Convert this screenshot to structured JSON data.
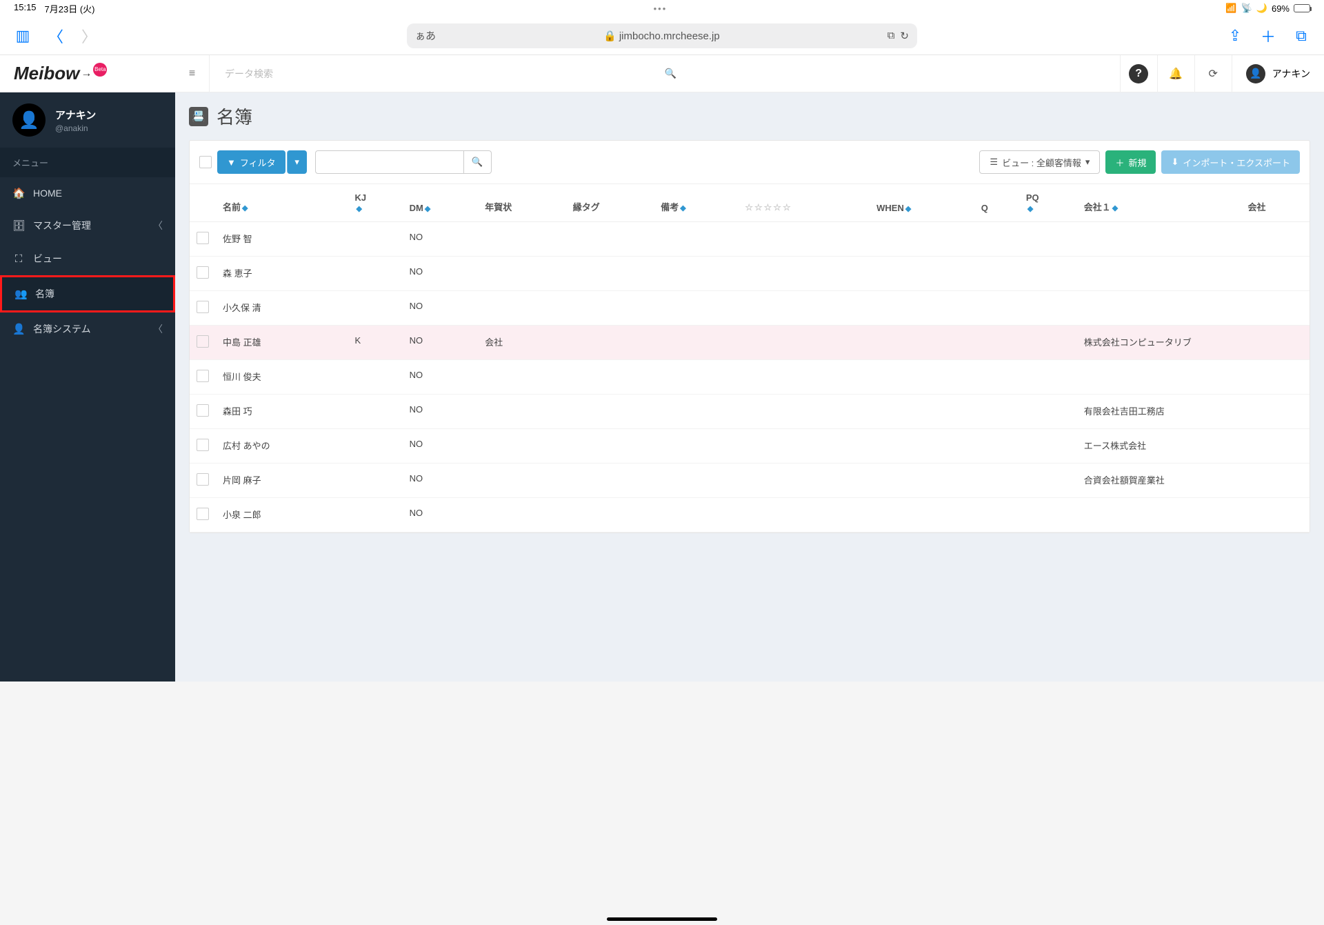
{
  "ios": {
    "time": "15:15",
    "date": "7月23日 (火)",
    "battery": "69%"
  },
  "safari": {
    "aa": "ぁあ",
    "lock": "🔒",
    "domain": "jimbocho.mrcheese.jp"
  },
  "logo": {
    "text": "Meibow",
    "badge": "Beta"
  },
  "profile": {
    "name": "アナキン",
    "handle": "@anakin"
  },
  "menu": {
    "label": "メニュー"
  },
  "nav": {
    "home": "HOME",
    "master": "マスター管理",
    "view": "ビュー",
    "meibo": "名簿",
    "system": "名簿システム"
  },
  "topbar": {
    "search_placeholder": "データ検索",
    "user": "アナキン"
  },
  "page": {
    "title": "名簿"
  },
  "toolbar": {
    "filter": "フィルタ",
    "view_btn": "ビュー : 全顧客情報",
    "new": "新規",
    "import": "インポート・エクスポート"
  },
  "columns": {
    "name": "名前",
    "kj": "KJ",
    "dm": "DM",
    "nengajo": "年賀状",
    "tag": "縁タグ",
    "biko": "備考",
    "stars": "",
    "when": "WHEN",
    "q": "Q",
    "pq": "PQ",
    "kaisha1": "会社１",
    "kaisha2": "会社"
  },
  "rows": [
    {
      "name": "佐野 智",
      "kj": "",
      "dm": "NO",
      "nengajo": "",
      "tag": "",
      "biko": "",
      "when": "",
      "q": "",
      "pq": "",
      "kaisha1": "",
      "highlight": false
    },
    {
      "name": "森 恵子",
      "kj": "",
      "dm": "NO",
      "nengajo": "",
      "tag": "",
      "biko": "",
      "when": "",
      "q": "",
      "pq": "",
      "kaisha1": "",
      "highlight": false
    },
    {
      "name": "小久保 清",
      "kj": "",
      "dm": "NO",
      "nengajo": "",
      "tag": "",
      "biko": "",
      "when": "",
      "q": "",
      "pq": "",
      "kaisha1": "",
      "highlight": false
    },
    {
      "name": "中島 正雄",
      "kj": "K",
      "dm": "NO",
      "nengajo": "会社",
      "tag": "",
      "biko": "",
      "when": "",
      "q": "",
      "pq": "",
      "kaisha1": "株式会社コンピュータリブ",
      "highlight": true
    },
    {
      "name": "恒川 俊夫",
      "kj": "",
      "dm": "NO",
      "nengajo": "",
      "tag": "",
      "biko": "",
      "when": "",
      "q": "",
      "pq": "",
      "kaisha1": "",
      "highlight": false
    },
    {
      "name": "森田 巧",
      "kj": "",
      "dm": "NO",
      "nengajo": "",
      "tag": "",
      "biko": "",
      "when": "",
      "q": "",
      "pq": "",
      "kaisha1": "有限会社吉田工務店",
      "highlight": false
    },
    {
      "name": "広村 あやの",
      "kj": "",
      "dm": "NO",
      "nengajo": "",
      "tag": "",
      "biko": "",
      "when": "",
      "q": "",
      "pq": "",
      "kaisha1": "エース株式会社",
      "highlight": false
    },
    {
      "name": "片岡 麻子",
      "kj": "",
      "dm": "NO",
      "nengajo": "",
      "tag": "",
      "biko": "",
      "when": "",
      "q": "",
      "pq": "",
      "kaisha1": "合資会社額賀産業社",
      "highlight": false
    },
    {
      "name": "小泉 二郎",
      "kj": "",
      "dm": "NO",
      "nengajo": "",
      "tag": "",
      "biko": "",
      "when": "",
      "q": "",
      "pq": "",
      "kaisha1": "",
      "highlight": false
    }
  ],
  "stars": "☆☆☆☆☆"
}
